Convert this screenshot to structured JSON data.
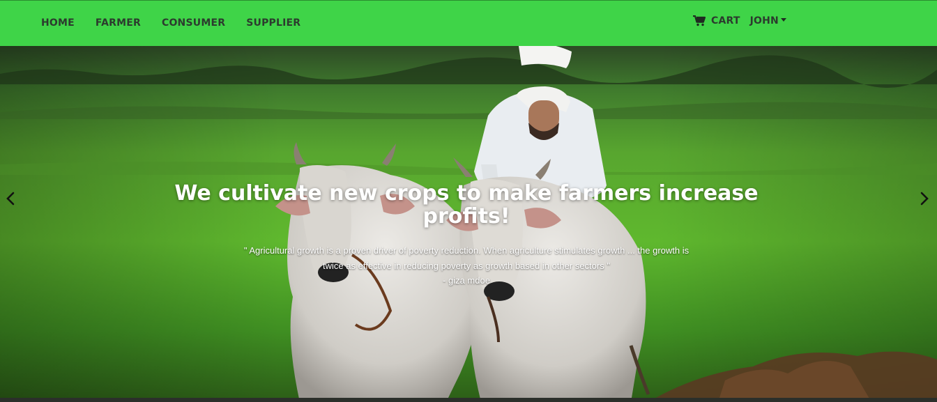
{
  "nav": {
    "links": [
      "HOME",
      "FARMER",
      "CONSUMER",
      "SUPPLIER"
    ],
    "cart_label": "CART",
    "user_label": "JOHN",
    "icons": {
      "cart": "shopping-cart-icon",
      "user_menu": "chevron-down-icon"
    }
  },
  "hero": {
    "headline": "We cultivate new crops to make farmers increase profits!",
    "quote": "\" Agricultural growth is a proven driver of poverty reduction. When agriculture stimulates growth ... the growth is twice as effective in reducing poverty as growth based in other sectors \"",
    "author": "- giza mdoe",
    "controls": {
      "prev_icon": "chevron-left-icon",
      "next_icon": "chevron-right-icon"
    }
  },
  "colors": {
    "navbar": "#3fd448",
    "nav_text": "#2c3b2e",
    "caption_text": "#ffffff"
  }
}
